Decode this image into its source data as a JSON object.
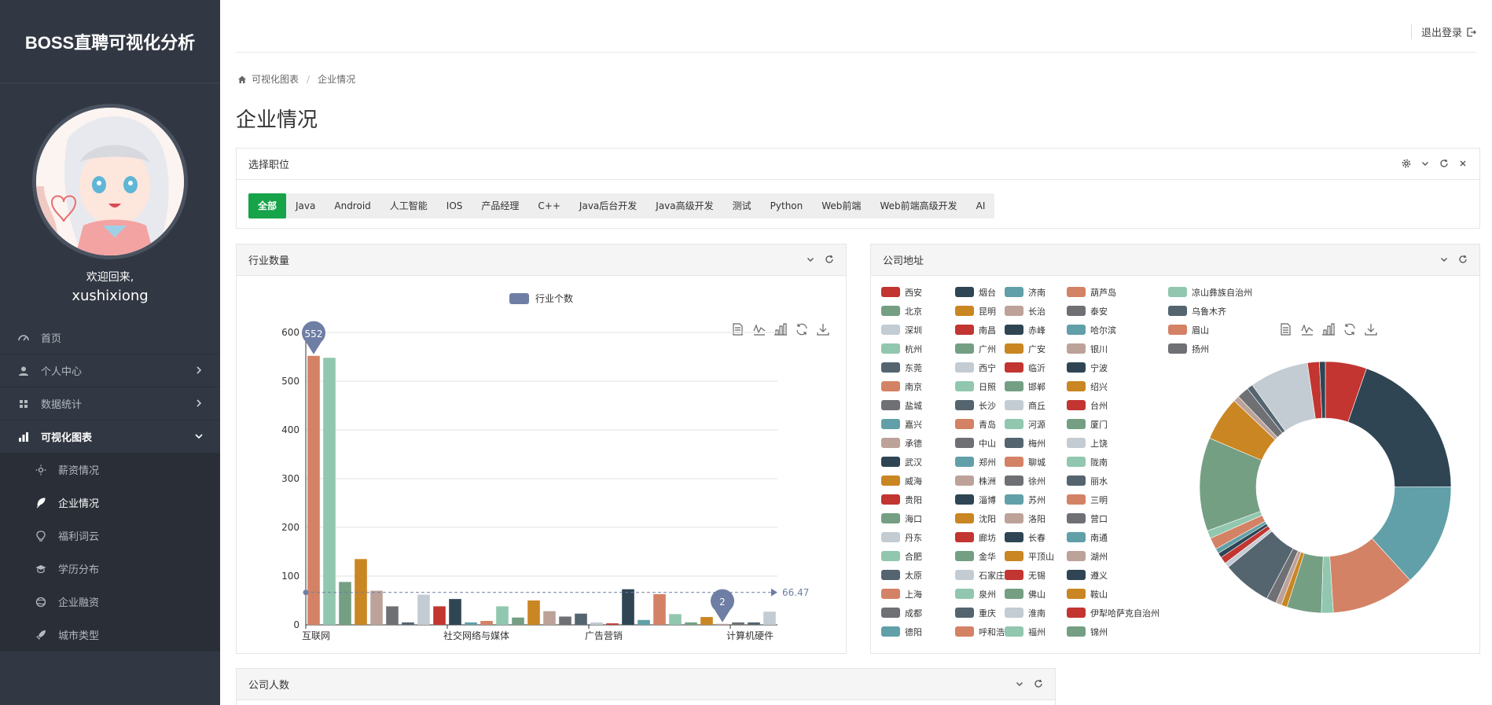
{
  "brand": {
    "title": "BOSS直聘可视化分析"
  },
  "user": {
    "welcome": "欢迎回来,",
    "name": "xushixiong"
  },
  "menu": {
    "home": "首页",
    "personal": "个人中心",
    "data_stats": "数据统计",
    "visual": "可视化图表",
    "sub": [
      "薪资情况",
      "企业情况",
      "福利词云",
      "学历分布",
      "企业融资",
      "城市类型"
    ]
  },
  "header": {
    "logout": "退出登录"
  },
  "breadcrumb": {
    "root": "可视化图表",
    "current": "企业情况"
  },
  "page": {
    "title": "企业情况"
  },
  "job_panel": {
    "title": "选择职位",
    "tabs": [
      "全部",
      "Java",
      "Android",
      "人工智能",
      "IOS",
      "产品经理",
      "C++",
      "Java后台开发",
      "Java高级开发",
      "测试",
      "Python",
      "Web前端",
      "Web前端高级开发",
      "AI"
    ],
    "active": "全部"
  },
  "colors": {
    "sidebar": "#323843",
    "accent_green": "#16a34a",
    "palette": [
      "#c23531",
      "#2f4554",
      "#61a0a8",
      "#d48265",
      "#91c7ae",
      "#749f83",
      "#ca8622",
      "#bda29a",
      "#6e7074",
      "#546570",
      "#c4ccd3"
    ]
  },
  "industry_panel": {
    "title": "行业数量"
  },
  "address_panel": {
    "title": "公司地址"
  },
  "size_panel": {
    "title": "公司人数"
  },
  "chart_data": [
    {
      "type": "bar",
      "legend": [
        "行业个数"
      ],
      "categories": [
        "互联网",
        "",
        "",
        "",
        "",
        "",
        "",
        "",
        "",
        "社交网络与媒体",
        "",
        "",
        "",
        "",
        "",
        "",
        "",
        "",
        "广告营销",
        "",
        "",
        "",
        "",
        "",
        "",
        "",
        "",
        "计算机硬件",
        "",
        "",
        "",
        "",
        ""
      ],
      "x_tick_labels": [
        "互联网",
        "社交网络与媒体",
        "广告营销",
        "计算机硬件"
      ],
      "values": [
        552,
        548,
        88,
        135,
        70,
        38,
        5,
        62,
        38,
        53,
        5,
        8,
        38,
        15,
        50,
        28,
        17,
        23,
        5,
        3,
        73,
        10,
        63,
        22,
        5,
        16,
        2,
        5,
        5,
        27
      ],
      "ylim": [
        0,
        600
      ],
      "yticks": [
        0,
        100,
        200,
        300,
        400,
        500,
        600
      ],
      "mark_points": [
        {
          "label": "552",
          "index": 0
        },
        {
          "label": "2",
          "index": 26
        }
      ],
      "mark_line": {
        "label": "66.47",
        "value": 66.47
      },
      "grid": true
    },
    {
      "type": "pie",
      "legend_columns": [
        [
          "西安",
          "北京",
          "深圳",
          "杭州",
          "东莞",
          "南京",
          "盐城",
          "嘉兴",
          "承德",
          "武汉",
          "威海",
          "贵阳",
          "海口",
          "丹东",
          "合肥",
          "太原",
          "上海",
          "成都",
          "德阳"
        ],
        [
          "烟台",
          "昆明",
          "南昌",
          "广州",
          "西宁",
          "日照",
          "长沙",
          "青岛",
          "中山",
          "郑州",
          "株洲",
          "淄博",
          "沈阳",
          "廊坊",
          "金华",
          "石家庄",
          "泉州",
          "重庆",
          "呼和浩特"
        ],
        [
          "济南",
          "长治",
          "赤峰",
          "广安",
          "临沂",
          "邯郸",
          "商丘",
          "河源",
          "梅州",
          "聊城",
          "徐州",
          "苏州",
          "洛阳",
          "长春",
          "平顶山",
          "无锡",
          "佛山",
          "淮南",
          "福州"
        ],
        [
          "葫芦岛",
          "泰安",
          "哈尔滨",
          "银川",
          "宁波",
          "绍兴",
          "台州",
          "厦门",
          "上饶",
          "陇南",
          "丽水",
          "三明",
          "营口",
          "南通",
          "湖州",
          "遵义",
          "鞍山",
          "伊犁哈萨克自治州",
          "锦州"
        ],
        [
          "凉山彝族自治州",
          "乌鲁木齐",
          "眉山",
          "扬州"
        ]
      ],
      "slices": [
        {
          "name": "西安",
          "value": 4.2
        },
        {
          "name": "北京",
          "value": 15.5
        },
        {
          "name": "深圳",
          "value": 10.5
        },
        {
          "name": "杭州",
          "value": 8.5
        },
        {
          "name": "东莞",
          "value": 1.2
        },
        {
          "name": "南京",
          "value": 3.5
        },
        {
          "name": "盐城",
          "value": 0.6
        },
        {
          "name": "嘉兴",
          "value": 0.6
        },
        {
          "name": "承德",
          "value": 1.0
        },
        {
          "name": "武汉",
          "value": 5.0
        },
        {
          "name": "威海",
          "value": 0.5
        },
        {
          "name": "贵阳",
          "value": 0.7
        },
        {
          "name": "海口",
          "value": 0.5
        },
        {
          "name": "丹东",
          "value": 0.5
        },
        {
          "name": "合肥",
          "value": 1.2
        },
        {
          "name": "太原",
          "value": 0.8
        },
        {
          "name": "上海",
          "value": 9.5
        },
        {
          "name": "成都",
          "value": 4.5
        },
        {
          "name": "德阳",
          "value": 0.6
        },
        {
          "name": "烟台",
          "value": 1.2
        },
        {
          "name": "昆明",
          "value": 0.6
        },
        {
          "name": "南昌",
          "value": 6.0
        },
        {
          "name": "广州",
          "value": 1.2
        },
        {
          "name": "西宁",
          "value": 0.6
        }
      ]
    }
  ]
}
